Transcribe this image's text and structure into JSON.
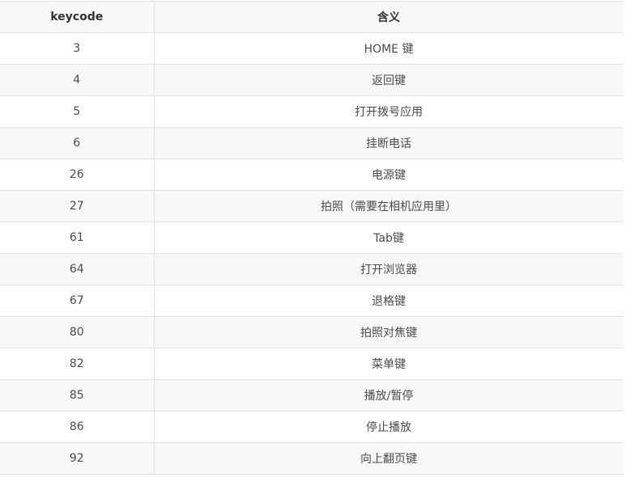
{
  "table": {
    "headers": [
      "keycode",
      "含义"
    ],
    "rows": [
      {
        "keycode": "3",
        "meaning": "HOME 键"
      },
      {
        "keycode": "4",
        "meaning": "返回键"
      },
      {
        "keycode": "5",
        "meaning": "打开拨号应用"
      },
      {
        "keycode": "6",
        "meaning": "挂断电话"
      },
      {
        "keycode": "26",
        "meaning": "电源键"
      },
      {
        "keycode": "27",
        "meaning": "拍照（需要在相机应用里）"
      },
      {
        "keycode": "61",
        "meaning": "Tab键"
      },
      {
        "keycode": "64",
        "meaning": "打开浏览器"
      },
      {
        "keycode": "67",
        "meaning": "退格键"
      },
      {
        "keycode": "80",
        "meaning": "拍照对焦键"
      },
      {
        "keycode": "82",
        "meaning": "菜单键"
      },
      {
        "keycode": "85",
        "meaning": "播放/暂停"
      },
      {
        "keycode": "86",
        "meaning": "停止播放"
      },
      {
        "keycode": "92",
        "meaning": "向上翻页键"
      }
    ]
  }
}
